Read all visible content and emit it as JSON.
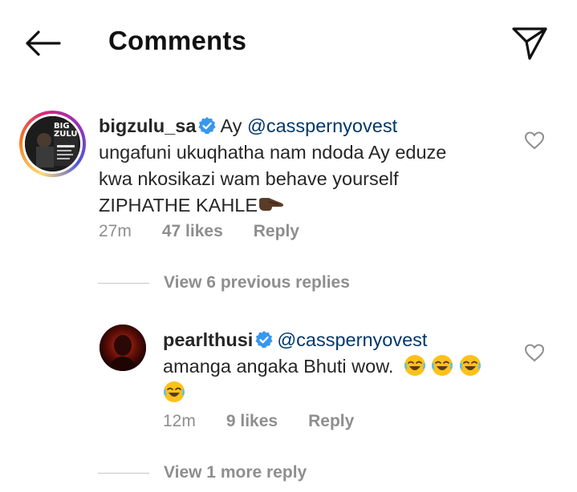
{
  "header": {
    "title": "Comments",
    "back_icon": "arrow-left-icon",
    "send_icon": "paper-plane-icon"
  },
  "colors": {
    "text": "#262626",
    "muted": "#8e8e8e",
    "mention": "#00376b",
    "verified": "#3897f0"
  },
  "comments": [
    {
      "username": "bigzulu_sa",
      "verified": true,
      "mention": "@cassper​nyovest",
      "text_intro": "Ay ",
      "line2": "ungafuni ukuqhatha nam ndoda Ay eduze",
      "line3": "kwa nkosikazi wam behave yourself",
      "line4": "ZIPHATHE KAHLE",
      "time": "27m",
      "likes": "47 likes",
      "reply_label": "Reply",
      "avatar_text_top": "BIG",
      "avatar_text_bottom": "ZULU"
    },
    {
      "username": "pearlthusi",
      "verified": true,
      "mention": "@cassper​nyovest",
      "line2": "amanga angaka Bhuti wow.",
      "time": "12m",
      "likes": "9 likes",
      "reply_label": "Reply"
    }
  ],
  "view_previous": "View 6 previous replies",
  "view_more": "View 1 more reply"
}
